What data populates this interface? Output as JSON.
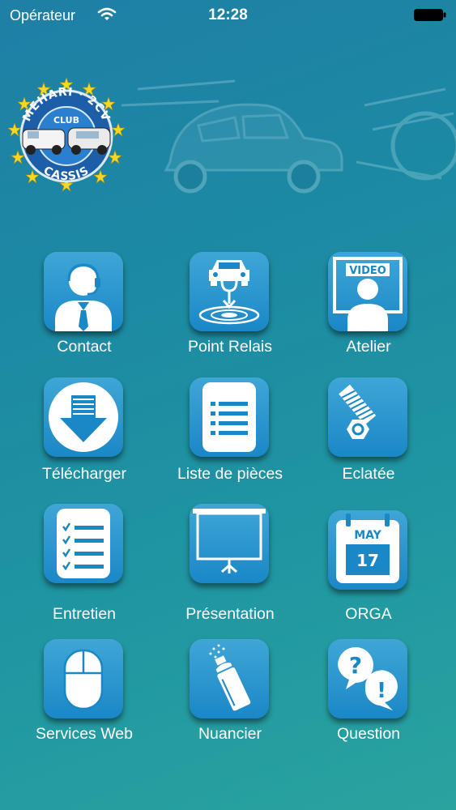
{
  "status": {
    "carrier": "Opérateur",
    "time": "12:28"
  },
  "logo": {
    "top_text": "MEHARI · 2CV",
    "middle_text": "CLUB",
    "bottom_text": "CASSIS"
  },
  "menu": [
    {
      "label": "Contact",
      "icon": "contact-icon"
    },
    {
      "label": "Point Relais",
      "icon": "point-relais-icon"
    },
    {
      "label": "Atelier",
      "icon": "video-icon",
      "icon_text": "VIDEO"
    },
    {
      "label": "Télécharger",
      "icon": "download-icon"
    },
    {
      "label": "Liste de pièces",
      "icon": "list-icon"
    },
    {
      "label": "Eclatée",
      "icon": "bolt-icon"
    },
    {
      "label": "Entretien",
      "icon": "checklist-icon"
    },
    {
      "label": "Présentation",
      "icon": "projector-screen-icon"
    },
    {
      "label": "ORGA",
      "icon": "calendar-icon",
      "icon_month": "MAY",
      "icon_day": "17"
    },
    {
      "label": "Services Web",
      "icon": "mouse-icon"
    },
    {
      "label": "Nuancier",
      "icon": "spray-can-icon"
    },
    {
      "label": "Question",
      "icon": "question-icon"
    }
  ],
  "colors": {
    "tile_top": "#3fa6d6",
    "tile_bottom": "#1a87c7",
    "background": "#1f8aa5"
  }
}
